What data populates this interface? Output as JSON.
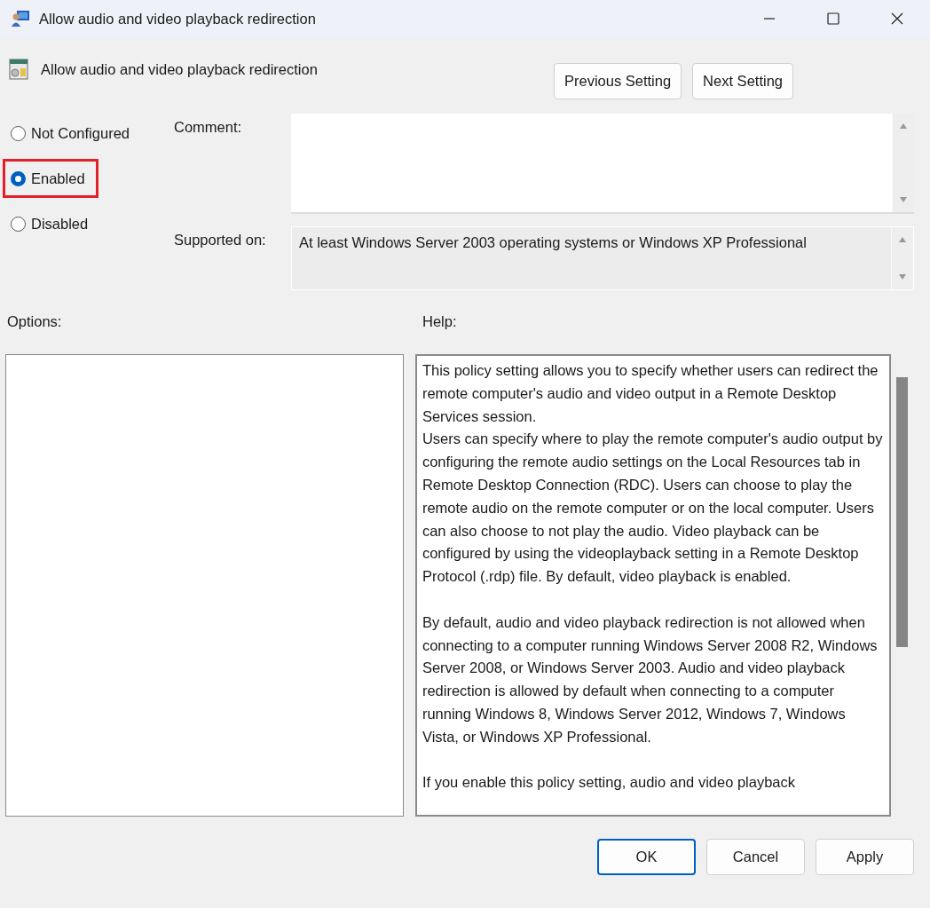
{
  "window": {
    "title": "Allow audio and video playback redirection"
  },
  "setting_title": "Allow audio and video playback redirection",
  "nav_buttons": [
    "Previous Setting",
    "Next Setting"
  ],
  "state_options": [
    {
      "label": "Not Configured",
      "selected": false,
      "highlighted": false
    },
    {
      "label": "Enabled",
      "selected": true,
      "highlighted": true
    },
    {
      "label": "Disabled",
      "selected": false,
      "highlighted": false
    }
  ],
  "comment": {
    "label": "Comment:"
  },
  "supported_on": {
    "label": "Supported on:",
    "value": "At least Windows Server 2003 operating systems or Windows XP Professional"
  },
  "options": {
    "label": "Options:"
  },
  "help": {
    "label": "Help:",
    "blocks": [
      [
        "This policy setting allows you to specify whether users can redirect the remote computer's audio and video output in a Remote Desktop Services session.",
        "Users can specify where to play the remote computer's audio output by configuring the remote audio settings on the Local Resources tab in Remote Desktop Connection (RDC). Users can choose to play the remote audio on the remote computer or on the local computer. Users can also choose to not play the audio. Video playback can be configured by using the videoplayback setting in a Remote Desktop Protocol (.rdp) file. By default, video playback is enabled."
      ],
      [
        "By default, audio and video playback redirection is not allowed when connecting to a computer running Windows Server 2008 R2, Windows Server 2008, or Windows Server 2003. Audio and video playback redirection is allowed by default when connecting to a computer running Windows 8, Windows Server 2012, Windows 7, Windows Vista, or Windows XP Professional."
      ],
      [
        "If you enable this policy setting, audio and video playback"
      ]
    ]
  },
  "footer_buttons": [
    {
      "label": "OK",
      "default": true
    },
    {
      "label": "Cancel",
      "default": false
    },
    {
      "label": "Apply",
      "default": false
    }
  ]
}
